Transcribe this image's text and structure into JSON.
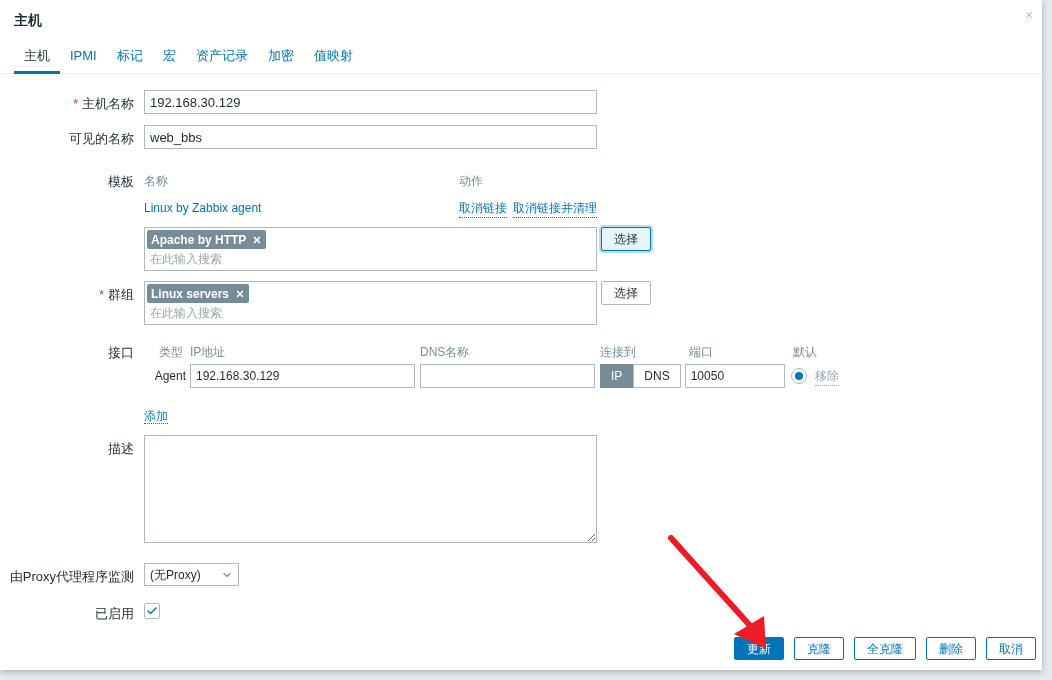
{
  "dialog": {
    "title": "主机"
  },
  "tabs": [
    {
      "label": "主机",
      "selected": true
    },
    {
      "label": "IPMI",
      "selected": false
    },
    {
      "label": "标记",
      "selected": false
    },
    {
      "label": "宏",
      "selected": false
    },
    {
      "label": "资产记录",
      "selected": false
    },
    {
      "label": "加密",
      "selected": false
    },
    {
      "label": "值映射",
      "selected": false
    }
  ],
  "host_name": {
    "label": "主机名称",
    "required_mark": "*",
    "value": "192.168.30.129"
  },
  "visible_name": {
    "label": "可见的名称",
    "value": "web_bbs"
  },
  "templates": {
    "label": "模板",
    "columns": [
      "名称",
      "动作"
    ],
    "linked": [
      {
        "name": "Linux by Zabbix agent",
        "actions": [
          "取消链接",
          "取消链接并清理"
        ]
      }
    ],
    "chips": [
      "Apache by HTTP"
    ],
    "placeholder": "在此输入搜索",
    "select_button": {
      "label": "选择",
      "focused": true
    }
  },
  "groups": {
    "label": "群组",
    "required_mark": "*",
    "chips": [
      "Linux servers"
    ],
    "placeholder": "在此输入搜索",
    "select_button": {
      "label": "选择",
      "focused": false
    }
  },
  "interfaces": {
    "label": "接口",
    "columns": [
      "类型",
      "IP地址",
      "DNS名称",
      "连接到",
      "端口",
      "默认"
    ],
    "rows": [
      {
        "type": "Agent",
        "ip": "192.168.30.129",
        "connect": [
          {
            "label": "IP",
            "selected": true
          },
          {
            "label": "DNS",
            "selected": false
          }
        ],
        "port": "10050",
        "default": true,
        "remove": "移除"
      }
    ],
    "add": "添加"
  },
  "description": {
    "label": "描述"
  },
  "proxy": {
    "label": "由Proxy代理程序监测",
    "value": "(无Proxy)"
  },
  "enabled": {
    "label": "已启用",
    "checked": true
  },
  "buttons": [
    {
      "label": "更新",
      "primary": true
    },
    {
      "label": "克隆",
      "primary": false
    },
    {
      "label": "全克隆",
      "primary": false
    },
    {
      "label": "删除",
      "primary": false
    },
    {
      "label": "取消",
      "primary": false
    }
  ],
  "annotation": {
    "kind": "arrow"
  }
}
